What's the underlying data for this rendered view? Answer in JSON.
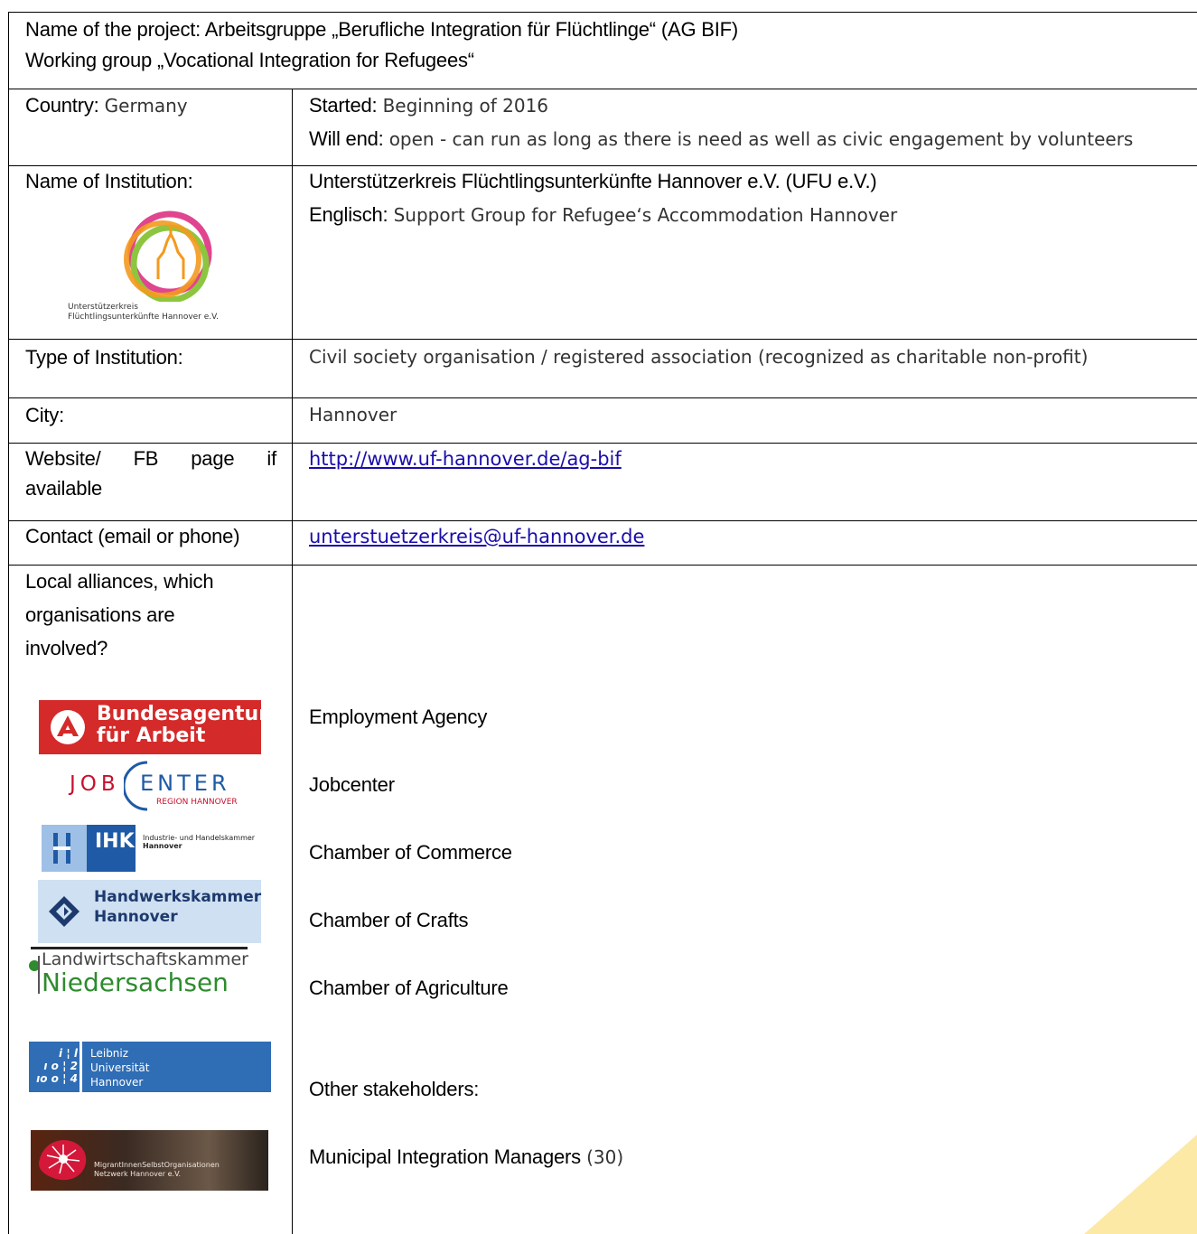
{
  "header": {
    "line1": "Name of the project: Arbeitsgruppe „Berufliche Integration für Flüchtlinge“ (AG BIF)",
    "line2": "Working group „Vocational Integration for Refugees“"
  },
  "country": {
    "label": "Country:",
    "value": "Germany"
  },
  "started": {
    "label": "Started:",
    "value": "Beginning of 2016"
  },
  "will_end": {
    "label": "Will end:",
    "value": "open - can run as long as there is need as well as civic engagement by volunteers"
  },
  "institution": {
    "label": "Name of Institution:",
    "name": "Unterstützerkreis Flüchtlingsunterkünfte Hannover e.V. (UFU e.V.)",
    "english_label": "Englisch:",
    "english_value": "Support Group for Refugee‘s Accommodation Hannover",
    "logo_text_1": "Unterstützerkreis",
    "logo_text_2": "Flüchtlingsunterkünfte Hannover e.V."
  },
  "type": {
    "label": "Type of Institution:",
    "value": "Civil society organisation / registered association (recognized as charitable non-profit)"
  },
  "city": {
    "label": "City:",
    "value": "Hannover"
  },
  "website": {
    "label_1": "Website/",
    "label_2": "FB",
    "label_3": "page",
    "label_4": "if",
    "label_5": "available",
    "url": "http://www.uf-hannover.de/ag-bif"
  },
  "contact": {
    "label": "Contact (email or phone)",
    "email": "unterstuetzerkreis@uf-hannover.de"
  },
  "alliances": {
    "label_1": "Local alliances, which",
    "label_2": "organisations are",
    "label_3": "involved?",
    "items": [
      "Employment Agency",
      "Jobcenter",
      "Chamber of Commerce",
      "Chamber of Crafts",
      "Chamber of Agriculture"
    ],
    "other_label": "Other stakeholders:",
    "municipal": "Municipal Integration Managers",
    "municipal_count": "(30)"
  },
  "logos": {
    "ba_1": "Bundesagentur",
    "ba_2": "für Arbeit",
    "jc_1": "JOB",
    "jc_2": "ENTER",
    "jc_3": "REGION HANNOVER",
    "ihk_1": "IHK",
    "ihk_2": "Industrie- und Handelskammer",
    "ihk_3": "Hannover",
    "hwk_1": "Handwerkskammer",
    "hwk_2": "Hannover",
    "lwk_1": "Landwirtschaftskammer",
    "lwk_2": "Niedersachsen",
    "luh_1": "Leibniz",
    "luh_2": "Universität",
    "luh_3": "Hannover",
    "luh_digits": "i ¦ l\n ı o ¦ 2\nıo o ¦ 4",
    "mso_1": "MigrantInnenSelbstOrganisationen",
    "mso_2": "Netzwerk Hannover e.V."
  },
  "colors": {
    "ba_red": "#d42a2a",
    "jc_red": "#c8102e",
    "jc_blue": "#1f5aa6",
    "ihk_blue": "#1f5aa6",
    "hwk_bg": "#cfe0f2",
    "lwk_green": "#2e8b2e",
    "luh_blue": "#2f6db5",
    "corner": "#fce9a6"
  }
}
